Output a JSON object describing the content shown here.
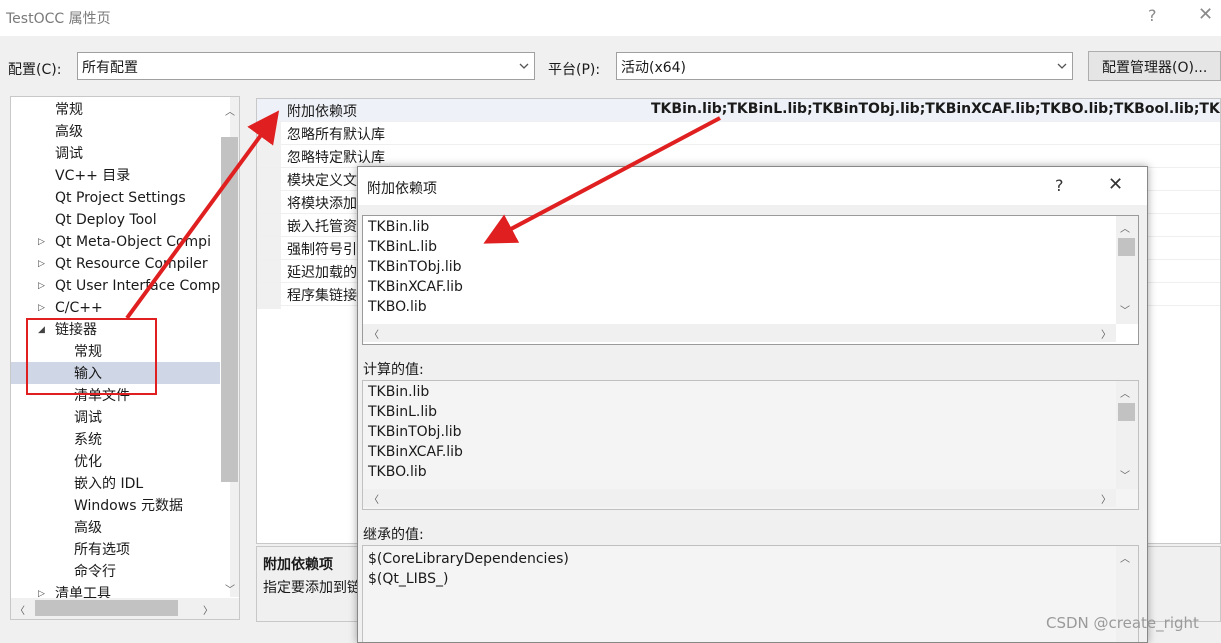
{
  "window": {
    "title": "TestOCC 属性页",
    "help": "?",
    "close": "✕"
  },
  "config": {
    "label": "配置(C):",
    "value": "所有配置",
    "platform_label": "平台(P):",
    "platform_value": "活动(x64)",
    "manager_button": "配置管理器(O)..."
  },
  "tree": {
    "items": [
      {
        "label": "常规"
      },
      {
        "label": "高级"
      },
      {
        "label": "调试"
      },
      {
        "label": "VC++ 目录"
      },
      {
        "label": "Qt Project Settings"
      },
      {
        "label": "Qt Deploy Tool"
      },
      {
        "label": "Qt Meta-Object Compi"
      },
      {
        "label": "Qt Resource Compiler"
      },
      {
        "label": "Qt User Interface Comp"
      },
      {
        "label": "C/C++"
      },
      {
        "label": "链接器"
      },
      {
        "label": "常规"
      },
      {
        "label": "输入"
      },
      {
        "label": "清单文件"
      },
      {
        "label": "调试"
      },
      {
        "label": "系统"
      },
      {
        "label": "优化"
      },
      {
        "label": "嵌入的 IDL"
      },
      {
        "label": "Windows 元数据"
      },
      {
        "label": "高级"
      },
      {
        "label": "所有选项"
      },
      {
        "label": "命令行"
      },
      {
        "label": "清单工具"
      }
    ]
  },
  "properties": {
    "rows": [
      {
        "name": "附加依赖项",
        "value": "TKBin.lib;TKBinL.lib;TKBinTObj.lib;TKBinXCAF.lib;TKBO.lib;TKBool.lib;TKBRep.lib"
      },
      {
        "name": "忽略所有默认库"
      },
      {
        "name": "忽略特定默认库"
      },
      {
        "name": "模块定义文"
      },
      {
        "name": "将模块添加"
      },
      {
        "name": "嵌入托管资"
      },
      {
        "name": "强制符号引"
      },
      {
        "name": "延迟加载的"
      },
      {
        "name": "程序集链接"
      }
    ]
  },
  "description": {
    "title": "附加依赖项",
    "text": "指定要添加到链"
  },
  "dialog": {
    "title": "附加依赖项",
    "help": "?",
    "close": "✕",
    "edit_lines": [
      "TKBin.lib",
      "TKBinL.lib",
      "TKBinTObj.lib",
      "TKBinXCAF.lib",
      "TKBO.lib"
    ],
    "computed_label": "计算的值:",
    "computed_lines": [
      "TKBin.lib",
      "TKBinL.lib",
      "TKBinTObj.lib",
      "TKBinXCAF.lib",
      "TKBO.lib"
    ],
    "inherited_label": "继承的值:",
    "inherited_lines": [
      "$(CoreLibraryDependencies)",
      "$(Qt_LIBS_)"
    ]
  },
  "watermark": "CSDN @create_right",
  "colors": {
    "annotation_red": "#e02020",
    "selection": "#cfd6e6"
  }
}
